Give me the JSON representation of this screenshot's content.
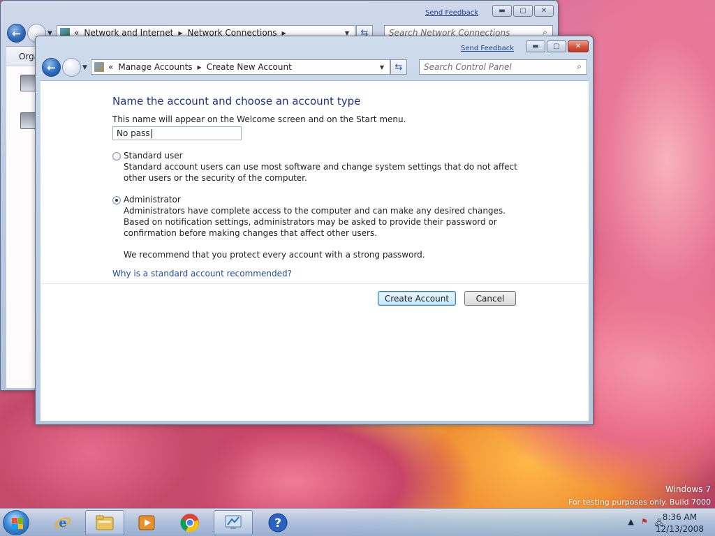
{
  "back_window": {
    "send_feedback": "Send Feedback",
    "address": [
      "Network and Internet",
      "Network Connections"
    ],
    "search_placeholder": "Search Network Connections",
    "toolbar_organize": "Orga"
  },
  "front_window": {
    "send_feedback": "Send Feedback",
    "address_prefix": "«",
    "address": [
      "Manage Accounts",
      "Create New Account"
    ],
    "search_placeholder": "Search Control Panel"
  },
  "form": {
    "title": "Name the account and choose an account type",
    "name_hint": "This name will appear on the Welcome screen and on the Start menu.",
    "name_value": "No pass",
    "standard": {
      "label": "Standard user",
      "description": "Standard account users can use most software and change system settings that do not affect other users or the security of the computer.",
      "selected": false
    },
    "administrator": {
      "label": "Administrator",
      "description": "Administrators have complete access to the computer and can make any desired changes. Based on notification settings, administrators may be asked to provide their password or confirmation before making changes that affect other users.",
      "selected": true
    },
    "recommendation": "We recommend that you protect every account with a strong password.",
    "link": "Why is a standard account recommended?",
    "create_button": "Create Account",
    "cancel_button": "Cancel"
  },
  "desktop": {
    "watermark_line1": "Windows 7",
    "watermark_line2": "For testing purposes only. Build 7000"
  },
  "taskbar": {
    "items": [
      "internet-explorer",
      "windows-explorer",
      "media-player",
      "chrome",
      "control-panel",
      "help"
    ],
    "time": "8:36 AM",
    "date": "12/13/2008"
  }
}
